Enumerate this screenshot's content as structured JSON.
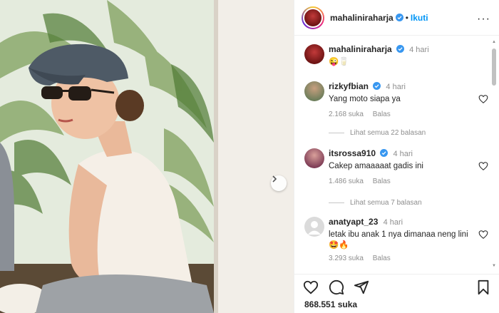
{
  "post": {
    "author": "mahaliniraharja",
    "follow_label": "Ikuti",
    "separator": "•",
    "more_label": "···"
  },
  "caption": {
    "username": "mahaliniraharja",
    "time": "4 hari",
    "text": "😜🥛"
  },
  "comments": [
    {
      "username": "rizkyfbian",
      "verified": true,
      "time": "4 hari",
      "text": "Yang moto siapa ya",
      "likes": "2.168 suka",
      "reply_label": "Balas",
      "view_replies": "Lihat semua 22 balasan"
    },
    {
      "username": "itsrossa910",
      "verified": true,
      "time": "4 hari",
      "text": "Cakep amaaaaat gadis ini",
      "likes": "1.486 suka",
      "reply_label": "Balas",
      "view_replies": "Lihat semua 7 balasan"
    },
    {
      "username": "anatyapt_23",
      "verified": false,
      "time": "4 hari",
      "text": "letak ibu anak 1 nya dimanaa neng lini🤩🔥",
      "likes": "3.293 suka",
      "reply_label": "Balas"
    }
  ],
  "likes_total": "868.551 suka",
  "colors": {
    "accent": "#0095f6",
    "verified": "#3897f0",
    "muted": "#8e8e8e"
  },
  "icons": [
    "verified-badge-icon",
    "heart-icon",
    "comment-icon",
    "share-icon",
    "bookmark-icon",
    "chevron-right-icon"
  ]
}
